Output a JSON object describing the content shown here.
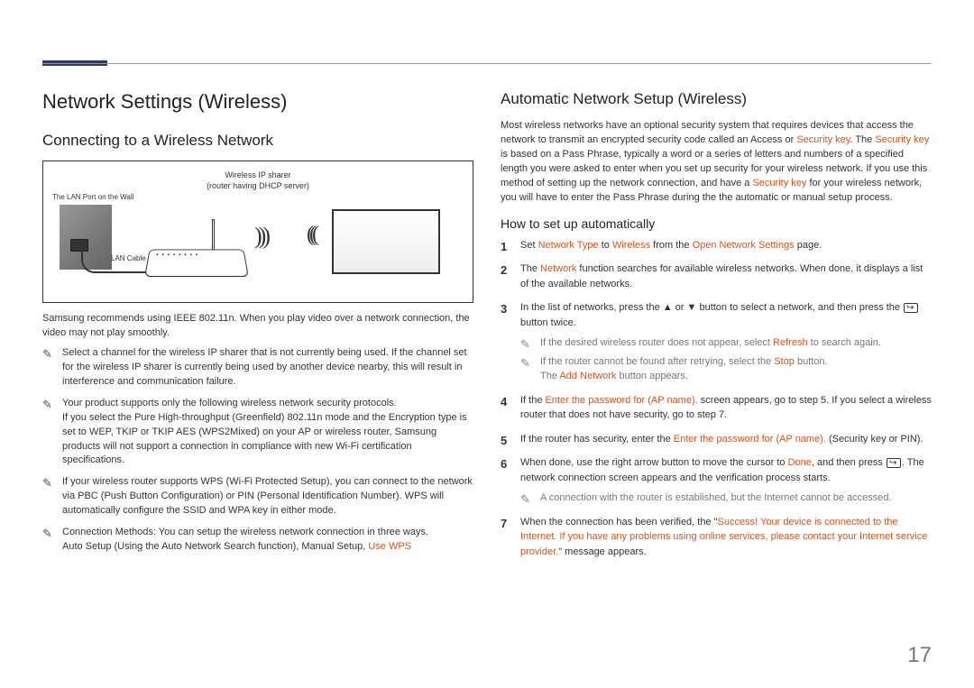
{
  "page_number": "17",
  "left": {
    "title": "Network Settings (Wireless)",
    "subtitle": "Connecting to a Wireless Network",
    "diagram": {
      "sharer_top": "Wireless IP sharer",
      "sharer_sub": "(router having DHCP server)",
      "wall_label": "The LAN Port on the Wall",
      "lan_cable": "LAN Cable"
    },
    "intro": "Samsung recommends using IEEE 802.11n. When you play video over a network connection, the video may not play smoothly.",
    "notes": [
      "Select a channel for the wireless IP sharer that is not currently being used. If the channel set for the wireless IP sharer is currently being used by another device nearby, this will result in interference and communication failure.",
      "Your product supports only the following wireless network security protocols.\nIf you select the Pure High-throughput (Greenfield) 802.11n mode and the Encryption type is set to WEP, TKIP or TKIP AES (WPS2Mixed) on your AP or wireless router, Samsung products will not support a connection in compliance with new Wi-Fi certification specifications.",
      "If your wireless router supports WPS (Wi-Fi Protected Setup), you can connect to the network via PBC (Push Button Configuration) or PIN (Personal Identification Number). WPS will automatically configure the SSID and WPA key in either mode.",
      {
        "prefix": "Connection Methods: You can setup the wireless network connection in three ways.\nAuto Setup (Using the Auto Network Search function), Manual Setup, ",
        "hl": "Use WPS"
      }
    ]
  },
  "right": {
    "title": "Automatic Network Setup (Wireless)",
    "intro": {
      "p1": "Most wireless networks have an optional security system that requires devices that access the network to transmit an encrypted security code called an Access or ",
      "hl1": "Security key",
      "p2": ". The ",
      "hl2": "Security key",
      "p3": " is based on a Pass Phrase, typically a word or a series of letters and numbers of a specified length you were asked to enter when you set up security for your wireless network. If you use this method of setting up the network connection, and have a ",
      "hl3": "Security key",
      "p4": " for your wireless network, you will have to enter the Pass Phrase during the the automatic or manual setup process."
    },
    "howto_title": "How to set up automatically",
    "steps": {
      "s1": {
        "p1": "Set ",
        "hl1": "Network Type",
        "p2": " to ",
        "hl2": "Wireless",
        "p3": " from the ",
        "hl3": "Open Network Settings",
        "p4": " page."
      },
      "s2": {
        "p1": "The ",
        "hl1": "Network",
        "p2": " function searches for available wireless networks. When done, it displays a list of the available networks."
      },
      "s3": {
        "p1": "In the list of networks, press the ▲ or ▼ button to select a network, and then press the ",
        "p2": " button twice."
      },
      "s3_notes": {
        "n1a": "If the desired wireless router does not appear, select ",
        "n1hl": "Refresh",
        "n1b": " to search again.",
        "n2a": "If the router cannot be found after retrying, select the ",
        "n2hl": "Stop",
        "n2b": " button.",
        "n2c": "The ",
        "n2hl2": "Add Network",
        "n2d": " button appears."
      },
      "s4": {
        "p1": "If the ",
        "hl1": "Enter the password for (AP name).",
        "p2": " screen appears, go to step 5. If you select a wireless router that does not have security, go to step 7."
      },
      "s5": {
        "p1": "If the router has security, enter the ",
        "hl1": "Enter the password for (AP name).",
        "p2": " (Security key or PIN)."
      },
      "s6": {
        "p1": "When done, use the right arrow button to move the cursor to ",
        "hl1": "Done",
        "p2": ", and then press ",
        "p3": ". The network connection screen appears and the verification process starts."
      },
      "s6_note": "A connection with the router is established, but the Internet cannot be accessed.",
      "s7": {
        "p1": "When the connection has been verified, the \"",
        "hl1": "Success! Your device is connected to the Internet. If you have any problems using online services, please contact your Internet service provider.",
        "p2": "\" message appears."
      }
    }
  }
}
